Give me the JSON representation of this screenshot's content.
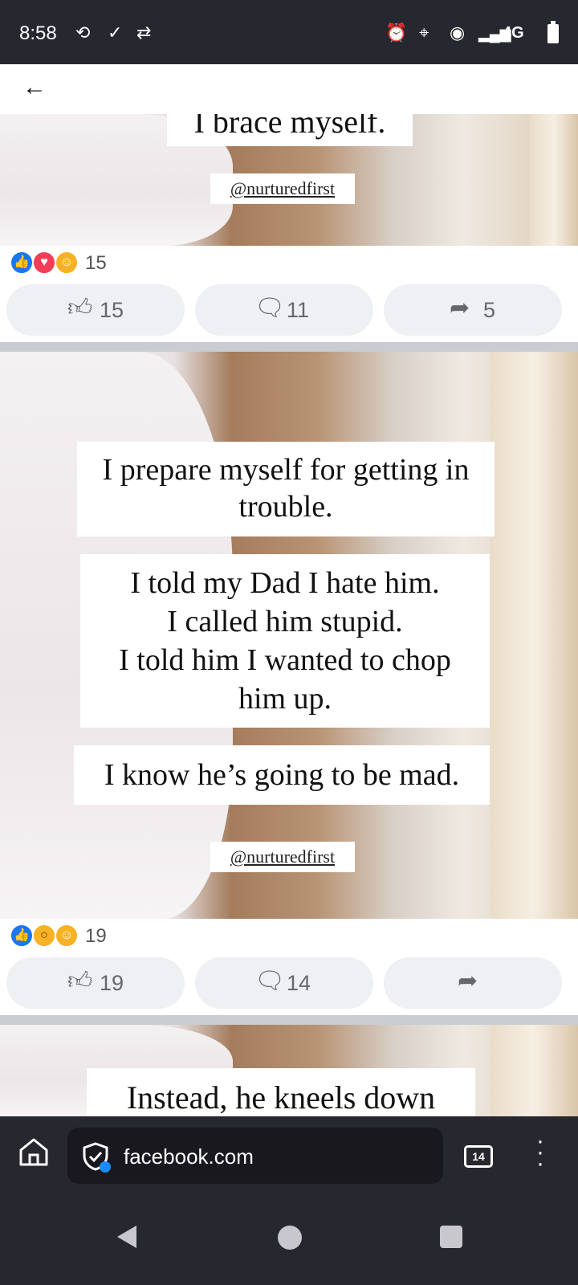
{
  "status_bar": {
    "time": "8:58",
    "network": "4G"
  },
  "browser": {
    "url": "facebook.com",
    "tab_count": "14"
  },
  "posts": [
    {
      "partial_text": "I brace myself.",
      "handle": "@nurturedfirst",
      "reaction_count": "15",
      "like_count": "15",
      "comment_count": "11",
      "share_count": "5",
      "reaction_icons": [
        "like-icon",
        "love-icon",
        "care-icon"
      ]
    },
    {
      "text_1": "I prepare myself for getting in trouble.",
      "text_2_lines": [
        "I told my Dad I hate him.",
        "I called him stupid.",
        "I told him I wanted to chop",
        "him up."
      ],
      "text_3": "I know he’s going to be mad.",
      "handle": "@nurturedfirst",
      "reaction_count": "19",
      "like_count": "19",
      "comment_count": "14",
      "share_count": "",
      "reaction_icons": [
        "like-icon",
        "wow-icon",
        "care-icon"
      ]
    },
    {
      "partial_text": "Instead, he kneels down"
    }
  ],
  "colors": {
    "like_blue": "#1877f2",
    "love_red": "#f33e58",
    "status_bg": "#27272f"
  }
}
